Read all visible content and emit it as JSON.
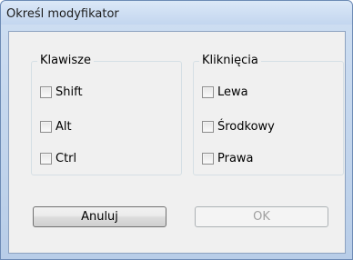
{
  "window": {
    "title": "Określ modyfikator"
  },
  "keys_group": {
    "title": "Klawisze",
    "items": [
      {
        "label": "Shift",
        "checked": false
      },
      {
        "label": "Alt",
        "checked": false
      },
      {
        "label": "Ctrl",
        "checked": false
      }
    ]
  },
  "clicks_group": {
    "title": "Kliknięcia",
    "items": [
      {
        "label": "Lewa",
        "checked": false
      },
      {
        "label": "Środkowy",
        "checked": false
      },
      {
        "label": "Prawa",
        "checked": false
      }
    ]
  },
  "buttons": {
    "cancel": "Anuluj",
    "ok": "OK"
  }
}
